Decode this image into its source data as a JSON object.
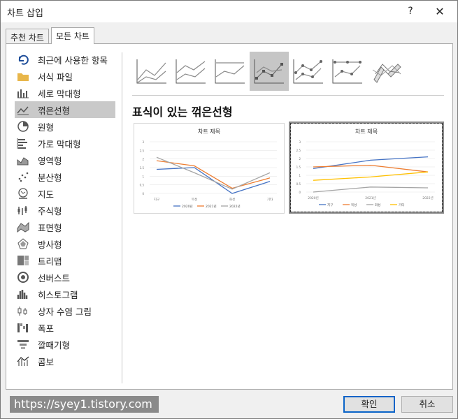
{
  "window": {
    "title": "차트 삽입",
    "help": "?",
    "close": "✕"
  },
  "tabs": [
    {
      "label": "추천 차트"
    },
    {
      "label": "모든 차트"
    }
  ],
  "sidebar": {
    "items": [
      {
        "label": "최근에 사용한 항목",
        "icon": "undo-icon"
      },
      {
        "label": "서식 파일",
        "icon": "folder-icon"
      },
      {
        "label": "세로 막대형",
        "icon": "column-chart-icon"
      },
      {
        "label": "꺾은선형",
        "icon": "line-chart-icon"
      },
      {
        "label": "원형",
        "icon": "pie-chart-icon"
      },
      {
        "label": "가로 막대형",
        "icon": "bar-chart-icon"
      },
      {
        "label": "영역형",
        "icon": "area-chart-icon"
      },
      {
        "label": "분산형",
        "icon": "scatter-chart-icon"
      },
      {
        "label": "지도",
        "icon": "map-icon"
      },
      {
        "label": "주식형",
        "icon": "stock-chart-icon"
      },
      {
        "label": "표면형",
        "icon": "surface-chart-icon"
      },
      {
        "label": "방사형",
        "icon": "radar-chart-icon"
      },
      {
        "label": "트리맵",
        "icon": "treemap-icon"
      },
      {
        "label": "선버스트",
        "icon": "sunburst-icon"
      },
      {
        "label": "히스토그램",
        "icon": "histogram-icon"
      },
      {
        "label": "상자 수염 그림",
        "icon": "box-whisker-icon"
      },
      {
        "label": "폭포",
        "icon": "waterfall-icon"
      },
      {
        "label": "깔때기형",
        "icon": "funnel-icon"
      },
      {
        "label": "콤보",
        "icon": "combo-chart-icon"
      }
    ],
    "selected": 3
  },
  "subtype_title": "표식이 있는 꺾은선형",
  "previews": [
    {
      "title": "차트 제목",
      "categories": [
        "지구",
        "목성",
        "화성",
        "기타"
      ],
      "yticks": [
        "3",
        "2.5",
        "2",
        "1.5",
        "1",
        "0.5",
        "0"
      ],
      "series": [
        {
          "name": "2020년",
          "color": "#4472c4",
          "values": [
            1.4,
            1.5,
            0,
            0.7
          ]
        },
        {
          "name": "2021년",
          "color": "#ed7d31",
          "values": [
            1.9,
            1.6,
            0.3,
            0.9
          ]
        },
        {
          "name": "2022년",
          "color": "#a5a5a5",
          "values": [
            2.1,
            1.2,
            0.25,
            1.2
          ]
        }
      ]
    },
    {
      "title": "차트 제목",
      "categories": [
        "2020년",
        "2021년",
        "2022년"
      ],
      "yticks": [
        "3",
        "2.5",
        "2",
        "1.5",
        "1",
        "0.5",
        "0"
      ],
      "series": [
        {
          "name": "지구",
          "color": "#4472c4",
          "values": [
            1.4,
            1.9,
            2.1
          ]
        },
        {
          "name": "목성",
          "color": "#ed7d31",
          "values": [
            1.5,
            1.6,
            1.2
          ]
        },
        {
          "name": "화성",
          "color": "#a5a5a5",
          "values": [
            0,
            0.3,
            0.25
          ]
        },
        {
          "name": "기타",
          "color": "#ffc000",
          "values": [
            0.7,
            0.9,
            1.2
          ]
        }
      ]
    }
  ],
  "buttons": {
    "ok": "확인",
    "cancel": "취소"
  },
  "watermark": "https://syey1.tistory.com"
}
